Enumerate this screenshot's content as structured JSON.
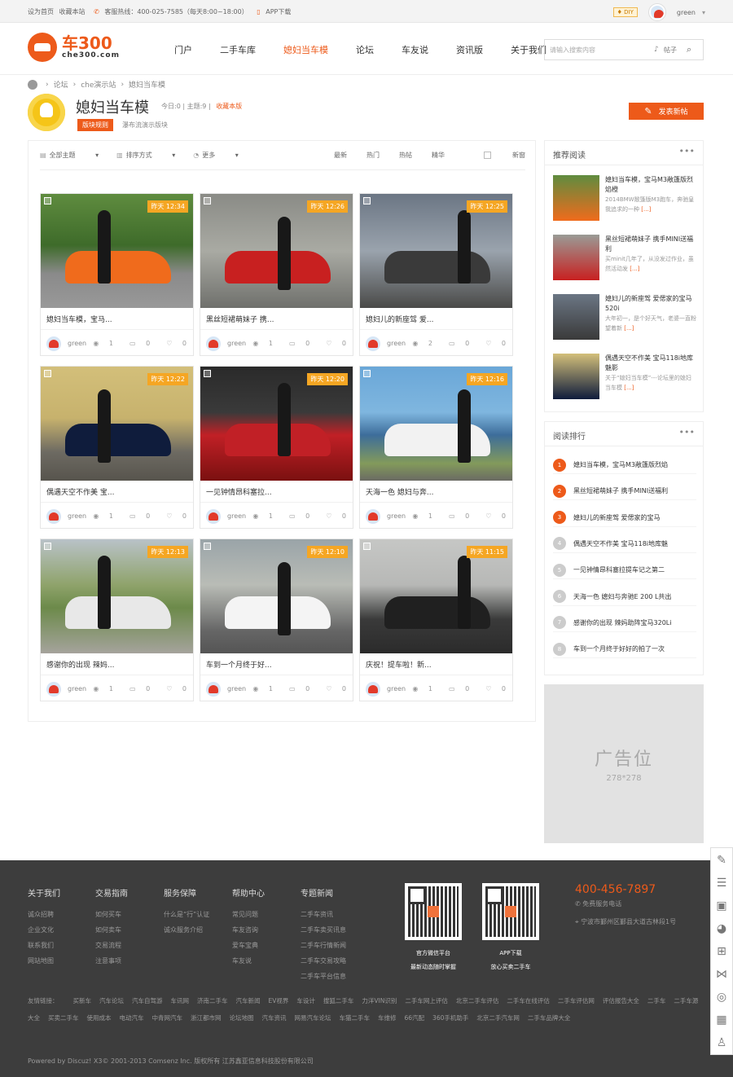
{
  "topbar": {
    "left_items": [
      "设为首页",
      "收藏本站",
      "客服热线：400-025-7585（每天8:00~18:00）",
      "APP下载"
    ],
    "diy": "DIY",
    "username": "green"
  },
  "logo": {
    "name": "车300",
    "domain": "che300.com"
  },
  "nav": {
    "items": [
      "门户",
      "二手车库",
      "媳妇当车模",
      "论坛",
      "车友说",
      "资讯版",
      "关于我们"
    ],
    "active_index": 2
  },
  "search": {
    "placeholder": "请输入搜索内容",
    "kind": "帖子"
  },
  "breadcrumb": [
    "论坛",
    "che演示站",
    "媳妇当车模"
  ],
  "forum": {
    "title": "媳妇当车模",
    "today": "今日:0",
    "topics": "主题:9",
    "fav": "收藏本版",
    "rule_btn": "版块规则",
    "desc": "瀑布流演示版块",
    "post_btn": "发表新帖"
  },
  "toolbar": {
    "all_topics": "全部主题",
    "sort": "排序方式",
    "more": "更多",
    "tabs": [
      "最新",
      "热门",
      "热帖",
      "精华"
    ],
    "new_window": "新窗"
  },
  "cards": [
    {
      "time": "昨天 12:34",
      "title": "媳妇当车模，宝马...",
      "user": "green",
      "views": "1",
      "replies": "0",
      "likes": "0"
    },
    {
      "time": "昨天 12:26",
      "title": "黑丝短裙萌妹子 携...",
      "user": "green",
      "views": "1",
      "replies": "0",
      "likes": "0"
    },
    {
      "time": "昨天 12:25",
      "title": "媳妇儿的新座驾 爱...",
      "user": "green",
      "views": "2",
      "replies": "0",
      "likes": "0"
    },
    {
      "time": "昨天 12:22",
      "title": "偶遇天空不作美 宝...",
      "user": "green",
      "views": "1",
      "replies": "0",
      "likes": "0"
    },
    {
      "time": "昨天 12:20",
      "title": "一见钟情昂科塞拉...",
      "user": "green",
      "views": "1",
      "replies": "0",
      "likes": "0"
    },
    {
      "time": "昨天 12:16",
      "title": "天海一色 媳妇与奔...",
      "user": "green",
      "views": "1",
      "replies": "0",
      "likes": "0"
    },
    {
      "time": "昨天 12:13",
      "title": "感谢你的出现 辣妈...",
      "user": "green",
      "views": "1",
      "replies": "0",
      "likes": "0"
    },
    {
      "time": "昨天 12:10",
      "title": "车到一个月终于好...",
      "user": "green",
      "views": "1",
      "replies": "0",
      "likes": "0"
    },
    {
      "time": "昨天 11:15",
      "title": "庆祝！提车啦！新...",
      "user": "green",
      "views": "1",
      "replies": "0",
      "likes": "0"
    }
  ],
  "recommend": {
    "title": "推荐阅读",
    "items": [
      {
        "title": "媳妇当车模，宝马M3敞篷版烈焰橙",
        "desc": "2014BMW敞篷版M3跑车，奔驰皇我追求的一种",
        "more": "[...]"
      },
      {
        "title": "黑丝短裙萌妹子 携手MINI送福利",
        "desc": "买minit几年了，从没发过作业，虽然活动发",
        "more": "[...]"
      },
      {
        "title": "媳妇儿的新座驾 爱偲家的宝马520i",
        "desc": "大年初一，是个好天气，老婆一直粉望着新",
        "more": "[...]"
      },
      {
        "title": "偶遇天空不作美 宝马118i地库魅影",
        "desc": "关于“媳妇当车模”---论坛里的媳妇当车模",
        "more": "[...]"
      }
    ]
  },
  "ranking": {
    "title": "阅读排行",
    "items": [
      "媳妇当车模，宝马M3敞篷版烈焰",
      "黑丝短裙萌妹子 携手MINI送福利",
      "媳妇儿的新座驾 爱偲家的宝马",
      "偶遇天空不作美 宝马118i地库魅",
      "一见钟情昂科塞拉提车记之第二",
      "天海一色 媳妇与奔驰E 200 L共出",
      "感谢你的出现 辣妈助阵宝马320Li",
      "车到一个月终于好好的拍了一次"
    ],
    "numbers": [
      "1",
      "2",
      "3",
      "4",
      "5",
      "6",
      "7",
      "8"
    ]
  },
  "ad": {
    "title": "广告位",
    "size": "278*278"
  },
  "footer": {
    "cols": [
      {
        "h": "关于我们",
        "items": [
          "诚众招聘",
          "企业文化",
          "联系我们",
          "网站地图"
        ]
      },
      {
        "h": "交易指南",
        "items": [
          "如何买车",
          "如何卖车",
          "交易流程",
          "注意事项"
        ]
      },
      {
        "h": "服务保障",
        "items": [
          "什么是“行”认证",
          "诚众服务介绍"
        ]
      },
      {
        "h": "帮助中心",
        "items": [
          "常见问题",
          "车友咨询",
          "爱车宝典",
          "车友说"
        ]
      },
      {
        "h": "专题新闻",
        "items": [
          "二手车资讯",
          "二手车卖买讯息",
          "二手车行情新闻",
          "二手车交易攻略",
          "二手车平台信息"
        ]
      }
    ],
    "qr1": {
      "line1": "官方微信平台",
      "line2": "最新动态随时掌握"
    },
    "qr2": {
      "line1": "APP下载",
      "line2": "放心买卖二手车"
    },
    "phone": "400-456-7897",
    "phone_sub": "免费服务电话",
    "address": "宁波市鄞州区鄞县大道古林段1号",
    "links_label": "友情链接：",
    "links": [
      "买新车",
      "汽车论坛",
      "汽车自驾游",
      "车讯网",
      "济南二手车",
      "汽车新闻",
      "EV视界",
      "车设计",
      "搜狐二手车",
      "力洋VIN识别",
      "二手车网上评估",
      "北京二手车评估",
      "二手车在线评估",
      "二手车评估网",
      "评估报告大全",
      "二手车",
      "二手车源大全",
      "买卖二手车",
      "使用成本",
      "电动汽车",
      "中青网汽车",
      "浙江都市网",
      "论坛地图",
      "汽车资讯",
      "网易汽车论坛",
      "车猫二手车",
      "车维修",
      "66汽配",
      "360手机助手",
      "北京二手汽车网",
      "二手车品牌大全"
    ],
    "copyright": "Powered by Discuz! X3© 2001-2013 Comsenz Inc. 版权所有 江苏鑫亚信息科技股份有限公司"
  },
  "colors": {
    "accent": "#ed5a1a",
    "time_badge": "#f5a623",
    "footer_bg": "#3d3d3d"
  }
}
